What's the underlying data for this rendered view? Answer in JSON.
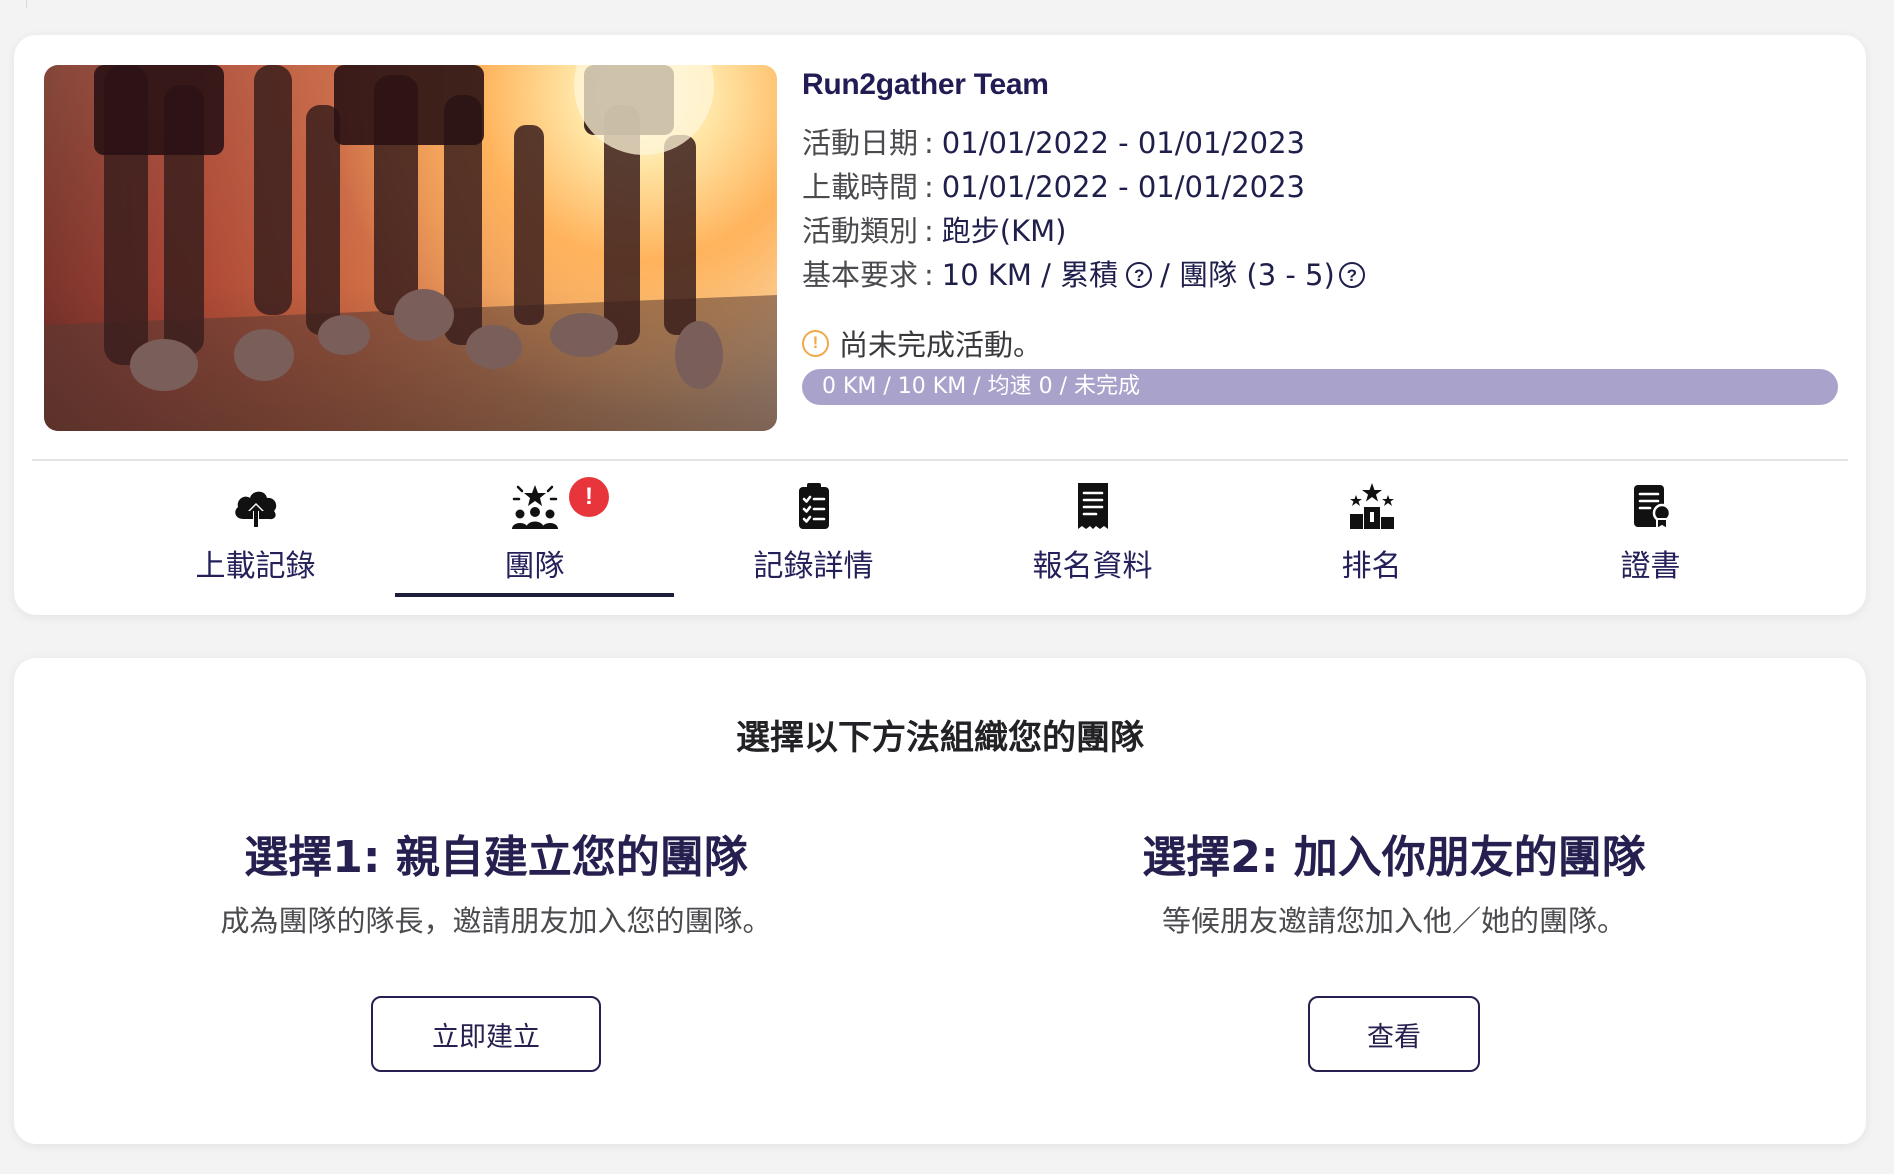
{
  "event": {
    "title": "Run2gather Team",
    "rows": [
      {
        "label": "活動日期",
        "value": "01/01/2022 - 01/01/2023"
      },
      {
        "label": "上載時間",
        "value": "01/01/2022 - 01/01/2023"
      },
      {
        "label": "活動類別",
        "value": "跑步(KM)"
      }
    ],
    "requirement": {
      "label": "基本要求",
      "part1": "10 KM / 累積",
      "part2": "/ 團隊 (3 - 5)",
      "help_icon_glyph": "?"
    },
    "separator": ":",
    "status_text": "尚未完成活動。",
    "status_icon_glyph": "!",
    "progress": {
      "text": "0 KM / 10 KM / 均速 0 / 未完成",
      "fraction": 0.0
    }
  },
  "tabs": [
    {
      "label": "上載記錄",
      "icon": "cloud-upload-icon",
      "active": false
    },
    {
      "label": "團隊",
      "icon": "team-icon",
      "active": true,
      "badge": "!"
    },
    {
      "label": "記錄詳情",
      "icon": "clipboard-check-icon",
      "active": false
    },
    {
      "label": "報名資料",
      "icon": "receipt-icon",
      "active": false
    },
    {
      "label": "排名",
      "icon": "podium-icon",
      "active": false
    },
    {
      "label": "證書",
      "icon": "certificate-icon",
      "active": false
    }
  ],
  "organize": {
    "title": "選擇以下方法組織您的團隊",
    "option1": {
      "title": "選擇1: 親自建立您的團隊",
      "desc": "成為團隊的隊長，邀請朋友加入您的團隊。",
      "button": "立即建立"
    },
    "option2": {
      "title": "選擇2: 加入你朋友的團隊",
      "desc": "等候朋友邀請您加入他／她的團隊。",
      "button": "查看"
    }
  },
  "colors": {
    "accent": "#25204f",
    "progress_track": "#a9a3cc",
    "warning": "#f0a84a",
    "badge": "#e8353b"
  }
}
